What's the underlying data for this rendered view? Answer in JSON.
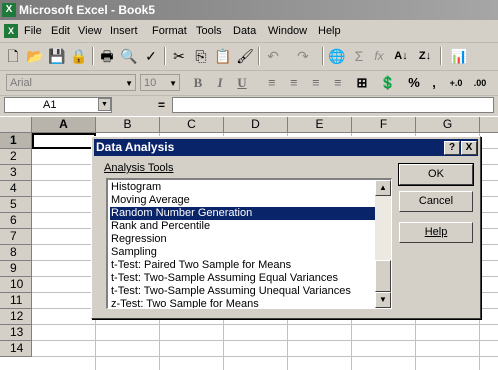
{
  "window": {
    "title": "Microsoft Excel - Book5"
  },
  "menu": [
    "File",
    "Edit",
    "View",
    "Insert",
    "Format",
    "Tools",
    "Data",
    "Window",
    "Help"
  ],
  "formatting": {
    "font": "Arial",
    "size": "10",
    "bold": "B",
    "italic": "I",
    "underline": "U",
    "percent": "%",
    "comma": ","
  },
  "formula_bar": {
    "cell_ref": "A1",
    "equals": "="
  },
  "grid": {
    "columns": [
      "A",
      "B",
      "C",
      "D",
      "E",
      "F",
      "G"
    ],
    "rows": [
      "1",
      "2",
      "3",
      "4",
      "5",
      "6",
      "7",
      "8",
      "9",
      "10",
      "11",
      "12",
      "13",
      "14"
    ]
  },
  "dialog": {
    "title": "Data Analysis",
    "help_q": "?",
    "close": "X",
    "label": "Analysis Tools",
    "items": [
      "Histogram",
      "Moving Average",
      "Random Number Generation",
      "Rank and Percentile",
      "Regression",
      "Sampling",
      "t-Test: Paired Two Sample for Means",
      "t-Test: Two-Sample Assuming Equal Variances",
      "t-Test: Two-Sample Assuming Unequal Variances",
      "z-Test: Two Sample for Means"
    ],
    "selected": "Random Number Generation",
    "buttons": {
      "ok": "OK",
      "cancel": "Cancel",
      "help": "Help"
    }
  }
}
